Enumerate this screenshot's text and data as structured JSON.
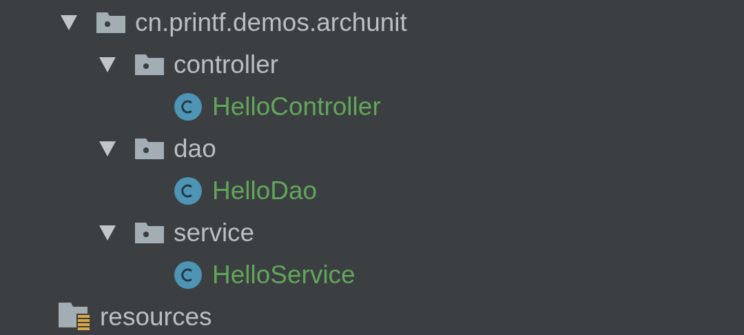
{
  "tree": [
    {
      "kind": "package",
      "label": "cn.printf.demos.archunit",
      "expanded": true,
      "children": [
        {
          "kind": "package",
          "label": "controller",
          "expanded": true,
          "children": [
            {
              "kind": "class",
              "label": "HelloController"
            }
          ]
        },
        {
          "kind": "package",
          "label": "dao",
          "expanded": true,
          "children": [
            {
              "kind": "class",
              "label": "HelloDao"
            }
          ]
        },
        {
          "kind": "package",
          "label": "service",
          "expanded": true,
          "children": [
            {
              "kind": "class",
              "label": "HelloService"
            }
          ]
        }
      ]
    },
    {
      "kind": "resources",
      "label": "resources"
    }
  ]
}
